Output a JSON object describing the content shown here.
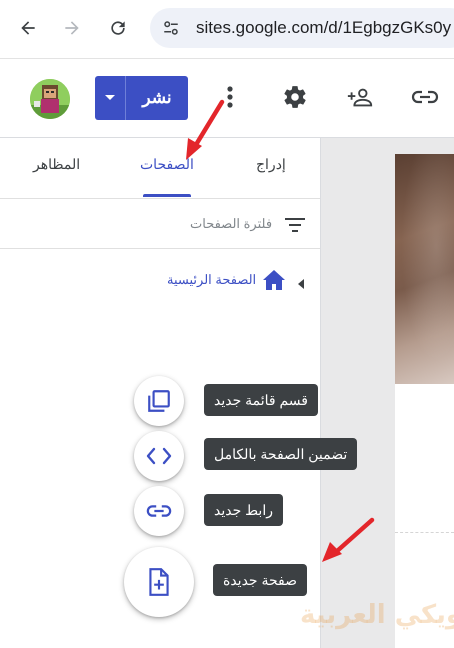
{
  "browser": {
    "url": "sites.google.com/d/1EgbgzGKs0y"
  },
  "toolbar": {
    "publish_label": "نشر",
    "icons": [
      "dropdown-arrow-icon",
      "more-vert-icon",
      "settings-gear-icon",
      "add-person-icon",
      "link-icon"
    ]
  },
  "tabs": [
    {
      "label": "إدراج",
      "active": false
    },
    {
      "label": "الصفحات",
      "active": true
    },
    {
      "label": "المظاهر",
      "active": false
    }
  ],
  "filter": {
    "placeholder": "فلترة الصفحات"
  },
  "pages": [
    {
      "label": "الصفحة الرئيسية",
      "icon": "home-icon"
    }
  ],
  "actions": [
    {
      "label": "قسم قائمة جديد",
      "icon": "copy-stack-icon"
    },
    {
      "label": "تضمين الصفحة بالكامل",
      "icon": "code-embed-icon"
    },
    {
      "label": "رابط جديد",
      "icon": "link-icon"
    },
    {
      "label": "صفحة جديدة",
      "icon": "new-page-icon"
    }
  ],
  "watermark": "ويكي العربية",
  "colors": {
    "accent": "#3c4fc4",
    "tooltip_bg": "#3c4043",
    "annotation": "#e3262b"
  }
}
